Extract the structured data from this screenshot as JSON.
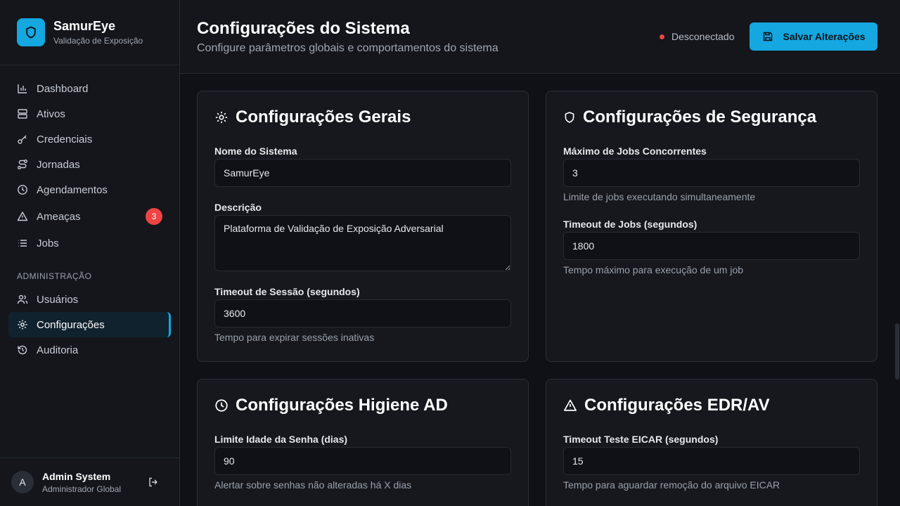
{
  "brand": {
    "name": "SamurEye",
    "subtitle": "Validação de Exposição"
  },
  "nav": {
    "items": [
      {
        "label": "Dashboard",
        "icon": "bar-chart-icon"
      },
      {
        "label": "Ativos",
        "icon": "server-icon"
      },
      {
        "label": "Credenciais",
        "icon": "key-icon"
      },
      {
        "label": "Jornadas",
        "icon": "route-icon"
      },
      {
        "label": "Agendamentos",
        "icon": "clock-icon"
      },
      {
        "label": "Ameaças",
        "icon": "alert-triangle-icon",
        "badge": "3"
      },
      {
        "label": "Jobs",
        "icon": "list-icon"
      }
    ],
    "admin_section": "ADMINISTRAÇÃO",
    "admin_items": [
      {
        "label": "Usuários",
        "icon": "users-icon"
      },
      {
        "label": "Configurações",
        "icon": "gear-icon",
        "active": true
      },
      {
        "label": "Auditoria",
        "icon": "history-icon"
      }
    ]
  },
  "user": {
    "initial": "A",
    "name": "Admin System",
    "role": "Administrador Global"
  },
  "header": {
    "title": "Configurações do Sistema",
    "subtitle": "Configure parâmetros globais e comportamentos do sistema",
    "status": "Desconectado",
    "save_label": "Salvar Alterações"
  },
  "general": {
    "title": "Configurações Gerais",
    "name_label": "Nome do Sistema",
    "name_value": "SamurEye",
    "desc_label": "Descrição",
    "desc_value": "Plataforma de Validação de Exposição Adversarial",
    "timeout_label": "Timeout de Sessão (segundos)",
    "timeout_value": "3600",
    "timeout_help": "Tempo para expirar sessões inativas"
  },
  "security": {
    "title": "Configurações de Segurança",
    "max_jobs_label": "Máximo de Jobs Concorrentes",
    "max_jobs_value": "3",
    "max_jobs_help": "Limite de jobs executando simultaneamente",
    "job_timeout_label": "Timeout de Jobs (segundos)",
    "job_timeout_value": "1800",
    "job_timeout_help": "Tempo máximo para execução de um job"
  },
  "ad_hygiene": {
    "title": "Configurações Higiene AD",
    "pwd_age_label": "Limite Idade da Senha (dias)",
    "pwd_age_value": "90",
    "pwd_age_help": "Alertar sobre senhas não alteradas há X dias"
  },
  "edr": {
    "title": "Configurações EDR/AV",
    "eicar_label": "Timeout Teste EICAR (segundos)",
    "eicar_value": "15",
    "eicar_help": "Tempo para aguardar remoção do arquivo EICAR"
  },
  "colors": {
    "accent": "#14a7e0",
    "danger": "#ef4444",
    "background": "#0f1116",
    "panel": "#16181e"
  }
}
